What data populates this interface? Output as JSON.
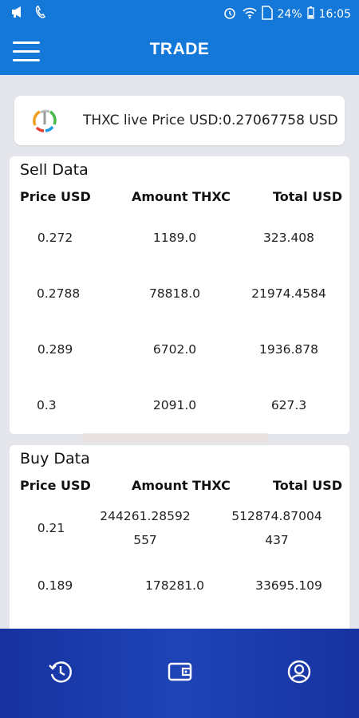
{
  "status_bar": {
    "battery": "24%",
    "time": "16:05"
  },
  "header": {
    "title": "TRADE"
  },
  "live_price": {
    "text": "THXC live Price USD:0.27067758 USD"
  },
  "columns": {
    "price": "Price USD",
    "amount": "Amount THXC",
    "total": "Total USD"
  },
  "sell": {
    "title": "Sell Data",
    "rows": [
      {
        "price": "0.272",
        "amount": "1189.0",
        "total": "323.408"
      },
      {
        "price": "0.2788",
        "amount": "78818.0",
        "total": "21974.4584"
      },
      {
        "price": "0.289",
        "amount": "6702.0",
        "total": "1936.878"
      },
      {
        "price": "0.3",
        "amount": "2091.0",
        "total": "627.3"
      }
    ]
  },
  "buy": {
    "title": "Buy Data",
    "rows": [
      {
        "price": "0.21",
        "amount_line1": "244261.28592",
        "amount_line2": "557",
        "total_line1": "512874.87004",
        "total_line2": "437"
      },
      {
        "price": "0.189",
        "amount": "178281.0",
        "total": "33695.109"
      }
    ]
  },
  "colors": {
    "primary": "#1478d8",
    "nav": "#1e44b8"
  }
}
